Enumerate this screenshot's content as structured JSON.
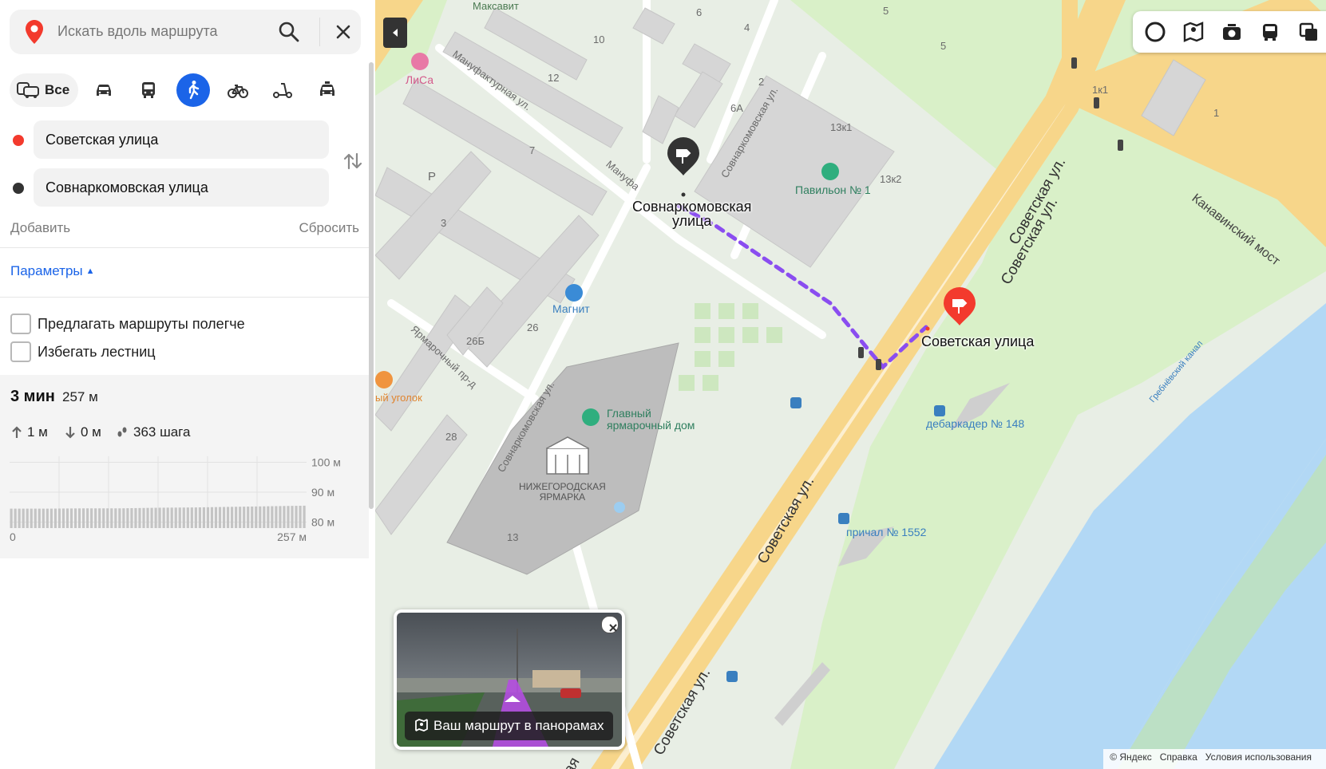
{
  "search": {
    "placeholder": "Искать вдоль маршрута"
  },
  "modes": {
    "all_label": "Все",
    "items": [
      {
        "id": "car",
        "icon": "car-icon"
      },
      {
        "id": "bus",
        "icon": "bus-icon"
      },
      {
        "id": "walk",
        "icon": "pedestrian-icon",
        "active": true
      },
      {
        "id": "bike",
        "icon": "bicycle-icon"
      },
      {
        "id": "scooter",
        "icon": "scooter-icon"
      },
      {
        "id": "taxi",
        "icon": "taxi-icon"
      }
    ]
  },
  "route": {
    "from": "Советская улица",
    "to": "Совнаркомовская улица",
    "add_label": "Добавить",
    "reset_label": "Сбросить",
    "params_label": "Параметры",
    "options": [
      {
        "label": "Предлагать маршруты полегче",
        "checked": false
      },
      {
        "label": "Избегать лестниц",
        "checked": false
      }
    ]
  },
  "summary": {
    "time": "3 мин",
    "distance": "257 м",
    "ascent": "1 м",
    "descent": "0 м",
    "steps": "363 шага",
    "elevation_axis": {
      "y_labels": [
        "100 м",
        "90 м",
        "80 м"
      ],
      "x_start": "0",
      "x_end": "257 м"
    }
  },
  "chart_data": {
    "type": "area",
    "title": "",
    "xlabel": "",
    "ylabel": "",
    "x_range": [
      0,
      257
    ],
    "ylim": [
      78,
      102
    ],
    "x": [
      0,
      32,
      64,
      96,
      128,
      160,
      192,
      224,
      257
    ],
    "values": [
      84.5,
      84.5,
      84.6,
      84.6,
      84.8,
      84.9,
      85.1,
      85.3,
      85.5
    ]
  },
  "map": {
    "labels": {
      "maksavit": "Максавит",
      "lisa": "ЛиСа",
      "manufakturnaya": "Мануфактурная ул.",
      "manufakturnaya2": "Мануфа",
      "sovnark_street_top": "Совнаркомовская ул.",
      "sovnark_street_low": "Совнаркомовская ул.",
      "yarmarochny": "Ярмарочный пр-д",
      "magnit": "Магнит",
      "pavilion": "Павильон № 1",
      "glavny": "Главный\nярмарочный дом",
      "yarmarka": "НИЖЕГОРОДСКАЯ\nЯРМАРКА",
      "ugolok": "ый уголок",
      "debarkader": "дебаркадер № 148",
      "prichal": "причал № 1552",
      "kanavinsky": "Канавинский мост",
      "grebnevsky": "Гребнёвский канал",
      "sovetskaya1": "Советская ул.",
      "sovetskaya2": "Советская ул.",
      "sovetskaya3": "Советская ул.",
      "sovetskaya4": "Советская ул.",
      "sovetskaya5": "Советская ул.",
      "sovetskaya6": "ая",
      "h10": "10",
      "h12": "12",
      "h7": "7",
      "h3": "3",
      "h26b": "26Б",
      "h26": "26",
      "h28": "28",
      "h13": "13",
      "h6": "6",
      "h4": "4",
      "h2": "2",
      "h6a": "6А",
      "h5a": "5",
      "h5b": "5",
      "h13k1": "13к1",
      "h13k2": "13к2",
      "h1k1": "1к1",
      "h1": "1",
      "p": "P"
    },
    "pins": {
      "end_label": "Совнаркомовская\nулица",
      "start_label": "Советская улица"
    },
    "panorama_button": "Ваш маршрут в панорамах",
    "attribution": [
      "© Яндекс",
      "Справка",
      "Условия использования"
    ]
  },
  "colors": {
    "accent": "#1b64e8",
    "start_point": "#f33a2d",
    "end_point": "#333333",
    "route_line": "#8a4df0",
    "water": "#b2d8f5",
    "road": "#f7d68a"
  }
}
